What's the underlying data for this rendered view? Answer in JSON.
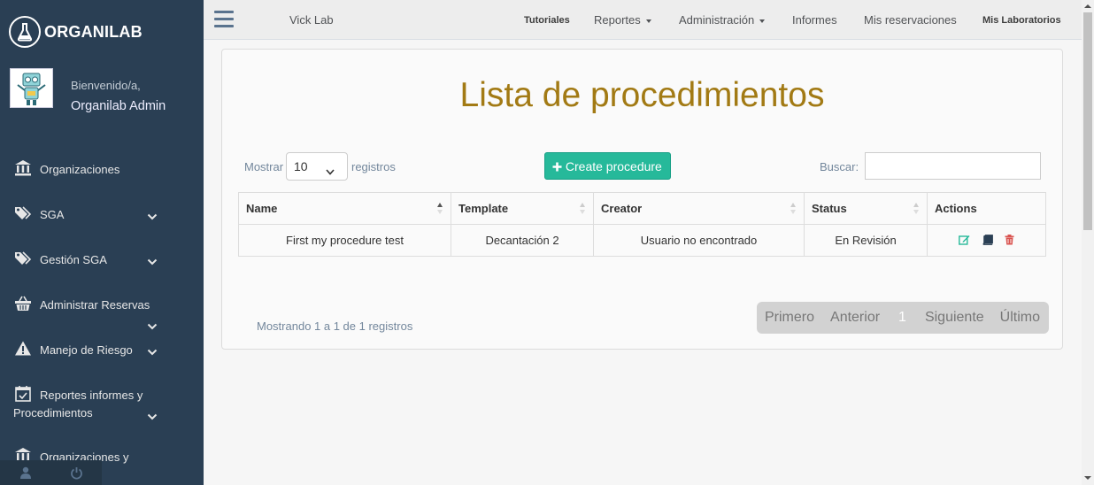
{
  "sidebar": {
    "brand": "ORGANILAB",
    "welcome": "Bienvenido/a,",
    "username": "Organilab Admin",
    "items": [
      {
        "label": "Organizaciones",
        "icon": "institution-icon",
        "chevron": false
      },
      {
        "label": "SGA",
        "icon": "tags-icon",
        "chevron": true
      },
      {
        "label": "Gestión SGA",
        "icon": "tags-icon",
        "chevron": true
      },
      {
        "label": "Administrar Reservas",
        "icon": "basket-icon",
        "chevron": true
      },
      {
        "label": "Manejo de Riesgo",
        "icon": "warning-icon",
        "chevron": true
      },
      {
        "label": "Reportes informes y",
        "label2": "Procedimientos",
        "icon": "calendar-check-icon",
        "chevron": true
      },
      {
        "label": "Organizaciones y",
        "icon": "institution-icon",
        "chevron": false
      }
    ]
  },
  "topnav": {
    "lab": "Vick Lab",
    "links": [
      {
        "label": "Tutoriales",
        "dropdown": false
      },
      {
        "label": "Reportes",
        "dropdown": true
      },
      {
        "label": "Administración",
        "dropdown": true
      },
      {
        "label": "Informes",
        "dropdown": false
      },
      {
        "label": "Mis reservaciones",
        "dropdown": false
      },
      {
        "label": "Mis Laboratorios",
        "dropdown": false
      }
    ]
  },
  "main": {
    "title": "Lista de procedimientos",
    "show_label": "Mostrar",
    "page_length": "10",
    "records_label": "registros",
    "create_button": "Create procedure",
    "search_label": "Buscar:",
    "search_value": "",
    "columns": [
      "Name",
      "Template",
      "Creator",
      "Status",
      "Actions"
    ],
    "rows": [
      {
        "name": "First my procedure test",
        "template": "Decantación 2",
        "creator": "Usuario no encontrado",
        "status": "En Revisión"
      }
    ],
    "info": "Mostrando 1 a 1 de 1 registros",
    "pagination": {
      "first": "Primero",
      "prev": "Anterior",
      "current": "1",
      "next": "Siguiente",
      "last": "Último"
    }
  },
  "colors": {
    "sidebar_bg": "#2a3f54",
    "title": "#a27a14",
    "primary_button": "#26b99a",
    "edit_icon": "#26b99a",
    "view_icon": "#2a3f54",
    "delete_icon": "#d9534f"
  }
}
